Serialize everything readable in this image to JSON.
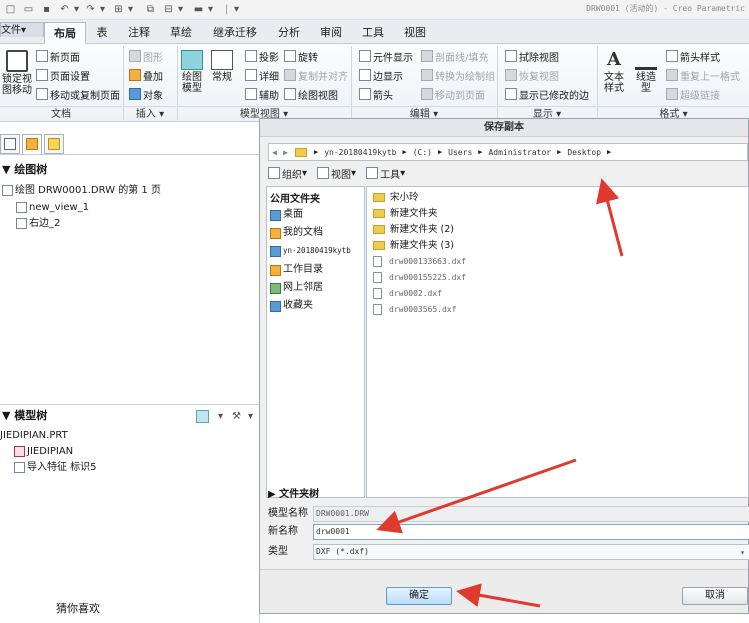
{
  "app": {
    "title": "DRW0001 (活动的) - Creo Parametric"
  },
  "tabs": [
    "文件",
    "布局",
    "表",
    "注释",
    "草绘",
    "继承迁移",
    "分析",
    "审阅",
    "工具",
    "视图"
  ],
  "ribbon": {
    "big_lock_line1": "锁定视",
    "big_lock_line2": "图移动",
    "new_page": "新页面",
    "page_setup": "页面设置",
    "move_copy_page": "移动或复制页面",
    "group_doc": "文档",
    "graphic": "图形",
    "overlay": "叠加",
    "object": "对象",
    "group_insert": "插入",
    "drawing_model": "绘图模型",
    "general": "常规",
    "projection": "投影",
    "detail": "详细",
    "auxiliary": "辅助",
    "rotate": "旋转",
    "copy_align": "复制并对齐",
    "drawing_view": "绘图视图",
    "group_model_views": "模型视图",
    "element_display": "元件显示",
    "edge_display": "边显示",
    "arrow": "箭头",
    "xsec_hatch": "剖面线/填充",
    "convert_to_draw": "转换为绘制组",
    "move_to_page": "移动到页面",
    "group_edit": "编辑",
    "erase_view": "拭除视图",
    "resume_view": "恢复视图",
    "show_modified_edges": "显示已修改的边",
    "group_display": "显示",
    "text_style": "文本样式",
    "line_style": "线造型",
    "arrow_style": "箭头样式",
    "repeat_format": "重复上一格式",
    "hyperlink": "超级链接",
    "group_format": "格式"
  },
  "left_panel": {
    "drawing_tree_title": "绘图树",
    "drawing_root": "绘图 DRW0001.DRW 的第 1 页",
    "view1": "new_view_1",
    "view2": "右边_2",
    "model_tree_title": "模型树",
    "part": "JIEDIPIAN.PRT",
    "part_node": "JIEDIPIAN",
    "import_feature": "导入特征 标识5",
    "bottom_note": "猜你喜欢"
  },
  "dialog": {
    "title": "保存副本",
    "path": [
      "yn-20180419kytb",
      "(C:)",
      "Users",
      "Administrator",
      "Desktop"
    ],
    "toolbar": {
      "organize": "组织",
      "views": "视图",
      "tools": "工具"
    },
    "places_title": "公用文件夹",
    "places": [
      "桌面",
      "我的文档",
      "yn-20180419kytb",
      "工作目录",
      "网上邻居",
      "收藏夹"
    ],
    "files": [
      {
        "name": "宋小玲",
        "type": "folder"
      },
      {
        "name": "新建文件夹",
        "type": "folder"
      },
      {
        "name": "新建文件夹 (2)",
        "type": "folder"
      },
      {
        "name": "新建文件夹 (3)",
        "type": "folder"
      },
      {
        "name": "drw000133663.dxf",
        "type": "file"
      },
      {
        "name": "drw000155225.dxf",
        "type": "file"
      },
      {
        "name": "drw0002.dxf",
        "type": "file"
      },
      {
        "name": "drw0003565.dxf",
        "type": "file"
      }
    ],
    "folder_tree": "文件夹树",
    "model_name_label": "模型名称",
    "model_name": "DRW0001.DRW",
    "new_name_label": "新名称",
    "new_name": "drw0001",
    "type_label": "类型",
    "type_value": "DXF (*.dxf)",
    "ok": "确定",
    "cancel": "取消"
  },
  "colors": {
    "accent": "#5a9bd8",
    "arrow": "#e03a2f",
    "folder": "#f2c94c"
  }
}
